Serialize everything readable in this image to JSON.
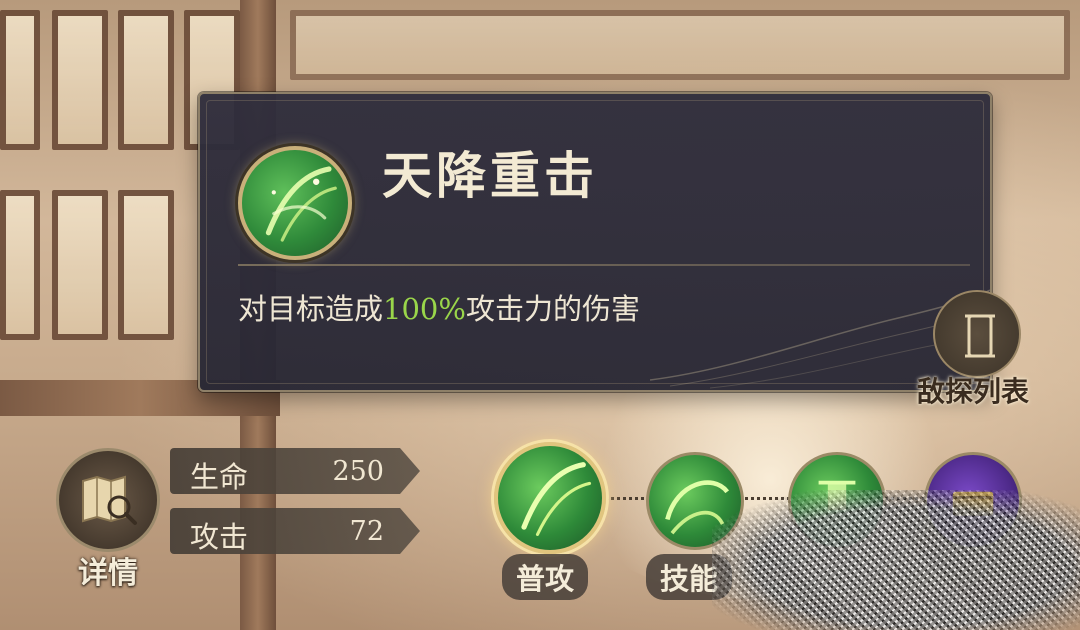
{
  "tooltip": {
    "skill_name": "天降重击",
    "description_prefix": "对目标造成",
    "description_highlight": "100%",
    "description_suffix": "攻击力的伤害",
    "highlight_color": "#9ad64a",
    "icon": "skill-slash-icon"
  },
  "enemy_list": {
    "label": "敌探列表",
    "icon": "scroll-icon"
  },
  "detail": {
    "label": "详情",
    "icon": "map-magnifier-icon"
  },
  "stats": [
    {
      "name": "生命",
      "value": "250"
    },
    {
      "name": "攻击",
      "value": "72"
    }
  ],
  "skills": [
    {
      "label": "普攻",
      "selected": true,
      "icon": "slash-icon"
    },
    {
      "label": "技能",
      "selected": false,
      "icon": "swirl-icon"
    },
    {
      "label": "",
      "selected": false,
      "icon": "figure-icon"
    },
    {
      "label": "",
      "selected": false,
      "icon": "purple-chest-icon"
    }
  ],
  "colors": {
    "tooltip_bg": "#2f2d3c",
    "gold_border": "#c9b07a",
    "text_light": "#f3ead3"
  }
}
